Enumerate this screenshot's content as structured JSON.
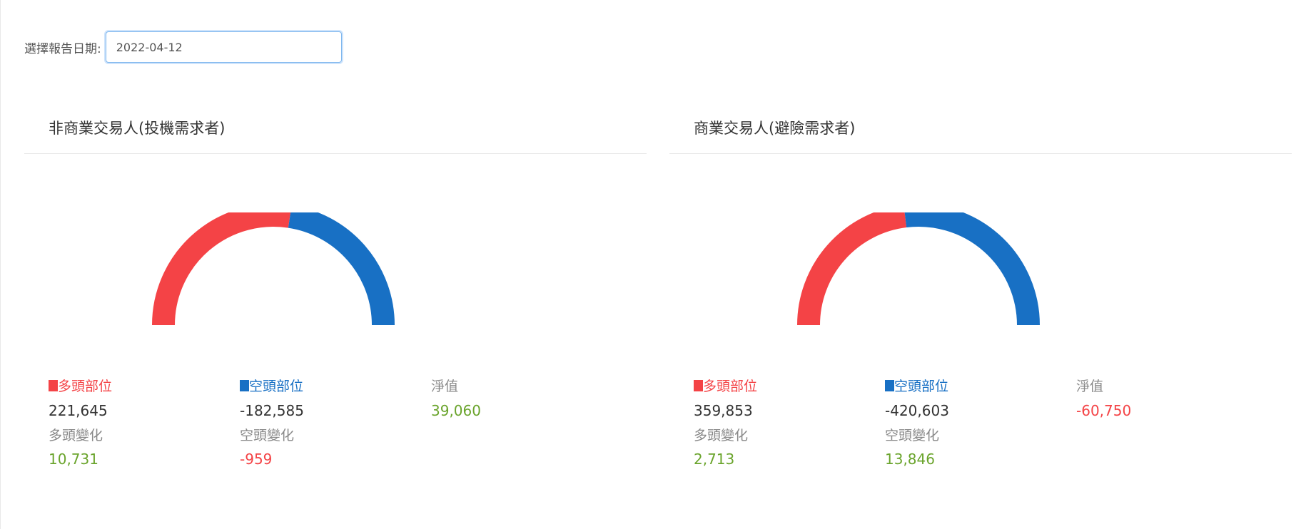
{
  "date_picker": {
    "label": "選擇報告日期:",
    "value": "2022-04-12"
  },
  "colors": {
    "long": "#f44346",
    "short": "#1870c4",
    "positive": "#6aa42c",
    "negative": "#f44346"
  },
  "panels": [
    {
      "title": "非商業交易人(投機需求者)",
      "long_label": "多頭部位",
      "short_label": "空頭部位",
      "net_label": "淨值",
      "long_value": "221,645",
      "short_value": "-182,585",
      "net_value": "39,060",
      "long_change_label": "多頭變化",
      "short_change_label": "空頭變化",
      "long_change": "10,731",
      "short_change": "-959",
      "gauge": {
        "long": 221645,
        "short": 182585
      }
    },
    {
      "title": "商業交易人(避險需求者)",
      "long_label": "多頭部位",
      "short_label": "空頭部位",
      "net_label": "淨值",
      "long_value": "359,853",
      "short_value": "-420,603",
      "net_value": "-60,750",
      "long_change_label": "多頭變化",
      "short_change_label": "空頭變化",
      "long_change": "2,713",
      "short_change": "13,846",
      "gauge": {
        "long": 359853,
        "short": 420603
      }
    }
  ]
}
